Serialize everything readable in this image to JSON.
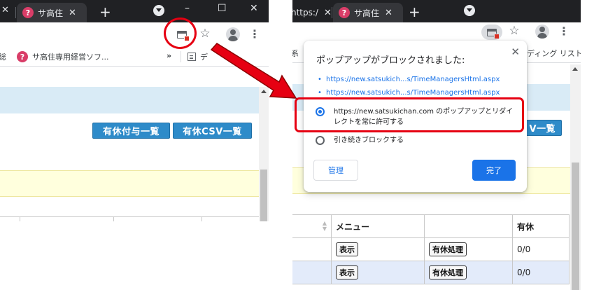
{
  "left_browser": {
    "tab_partial_close": "✕",
    "tab": {
      "label": "サ高住",
      "favicon": "?"
    },
    "new_tab": "+",
    "window_controls": {
      "minimize": "–",
      "maximize": "☐",
      "close": "✕"
    },
    "bookmarks": [
      {
        "label": "総"
      },
      {
        "label": "サ高住専用経営ソフ...",
        "favicon": "?"
      }
    ],
    "bookmarks_overflow": "»",
    "reading_list_label": "デ",
    "buttons": [
      "有休付与一覧",
      "有休CSV一覧"
    ]
  },
  "right_browser": {
    "tab_url_partial": "https:/",
    "tab_close": "✕",
    "tab": {
      "label": "サ高住",
      "favicon": "?"
    },
    "new_tab": "+",
    "bookmark_partial": "系",
    "reading_list_label": "ディング リスト",
    "button_partial": "V一覧",
    "table": {
      "columns": [
        "",
        "メニュー",
        "",
        "有休"
      ],
      "rows": [
        {
          "view_button": "表示",
          "action_button": "有休処理",
          "value": "0/0"
        },
        {
          "view_button": "表示",
          "action_button": "有休処理",
          "value": "0/0"
        }
      ]
    }
  },
  "popup": {
    "title": "ポップアップがブロックされました:",
    "close": "✕",
    "links": [
      "https://new.satsukich...s/TimeManagersHtml.aspx",
      "https://new.satsukich...s/TimeManagersHtml.aspx"
    ],
    "options": [
      {
        "label_line1": "https://new.satsukichan.com のポップアップとリダイ",
        "label_line2": "レクトを常に許可する",
        "selected": true
      },
      {
        "label_line1": "引き続きブロックする",
        "label_line2": "",
        "selected": false
      }
    ],
    "manage_button": "管理",
    "done_button": "完了"
  },
  "colors": {
    "accent": "#1a73e8",
    "highlight_red": "#e60012",
    "page_button_blue": "#2e8bc9",
    "tabbar": "#202124"
  },
  "icons": [
    "popup-blocked-icon",
    "star-icon",
    "avatar-icon",
    "kebab-menu-icon",
    "reading-list-icon",
    "arrow-pointer-icon"
  ]
}
